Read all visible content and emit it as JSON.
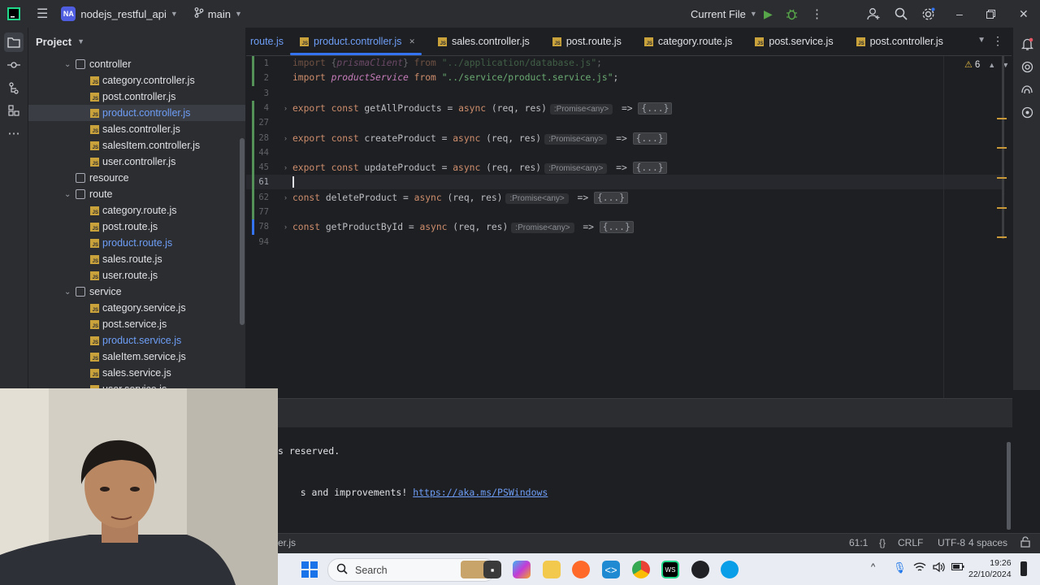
{
  "titlebar": {
    "project_badge": "NA",
    "project_name": "nodejs_restful_api",
    "branch": "main",
    "run_config": "Current File"
  },
  "project_panel": {
    "title": "Project",
    "tree": [
      {
        "type": "folder",
        "label": "controller",
        "indent": 1,
        "open": true
      },
      {
        "type": "file",
        "label": "category.controller.js",
        "indent": 2
      },
      {
        "type": "file",
        "label": "post.controller.js",
        "indent": 2
      },
      {
        "type": "file",
        "label": "product.controller.js",
        "indent": 2,
        "selected": true,
        "highlight": true
      },
      {
        "type": "file",
        "label": "sales.controller.js",
        "indent": 2
      },
      {
        "type": "file",
        "label": "salesItem.controller.js",
        "indent": 2
      },
      {
        "type": "file",
        "label": "user.controller.js",
        "indent": 2
      },
      {
        "type": "folder",
        "label": "resource",
        "indent": 1,
        "open": false
      },
      {
        "type": "folder",
        "label": "route",
        "indent": 1,
        "open": true
      },
      {
        "type": "file",
        "label": "category.route.js",
        "indent": 2
      },
      {
        "type": "file",
        "label": "post.route.js",
        "indent": 2
      },
      {
        "type": "file",
        "label": "product.route.js",
        "indent": 2,
        "highlight": true
      },
      {
        "type": "file",
        "label": "sales.route.js",
        "indent": 2
      },
      {
        "type": "file",
        "label": "user.route.js",
        "indent": 2
      },
      {
        "type": "folder",
        "label": "service",
        "indent": 1,
        "open": true
      },
      {
        "type": "file",
        "label": "category.service.js",
        "indent": 2
      },
      {
        "type": "file",
        "label": "post.service.js",
        "indent": 2
      },
      {
        "type": "file",
        "label": "product.service.js",
        "indent": 2,
        "highlight": true
      },
      {
        "type": "file",
        "label": "saleItem.service.js",
        "indent": 2
      },
      {
        "type": "file",
        "label": "sales.service.js",
        "indent": 2
      },
      {
        "type": "file",
        "label": "user.service.js",
        "indent": 2
      }
    ]
  },
  "tabs": [
    {
      "label": "route.js",
      "active": false,
      "partial": true
    },
    {
      "label": "product.controller.js",
      "active": true,
      "closable": true
    },
    {
      "label": "sales.controller.js",
      "active": false
    },
    {
      "label": "post.route.js",
      "active": false
    },
    {
      "label": "category.route.js",
      "active": false
    },
    {
      "label": "post.service.js",
      "active": false
    },
    {
      "label": "post.controller.js",
      "active": false
    }
  ],
  "editor": {
    "warnings_count": "6",
    "lines": [
      {
        "num": "1",
        "html": "<span class='dim'><span class='kw'>import</span> {<span class='it'>prismaClient</span>} <span class='kw'>from</span> <span class='str'>\"../application/database.js\"</span>;</span>"
      },
      {
        "num": "2",
        "html": "<span class='kw'>import</span> <span class='it'>productService</span> <span class='kw'>from</span> <span class='str'>\"../service/product.service.js\"</span>;"
      },
      {
        "num": "3",
        "html": ""
      },
      {
        "num": "4",
        "fold": true,
        "html": "<span class='kw'>export const</span> getAllProducts = <span class='kw'>async</span> (req, res)<span class='hint'>:Promise&lt;any&gt;</span> =&gt; <span class='folded'>{...}</span>"
      },
      {
        "num": "27",
        "html": ""
      },
      {
        "num": "28",
        "fold": true,
        "html": "<span class='kw'>export const</span> createProduct = <span class='kw'>async</span> (req, res)<span class='hint'>:Promise&lt;any&gt;</span> =&gt; <span class='folded'>{...}</span>"
      },
      {
        "num": "44",
        "html": ""
      },
      {
        "num": "45",
        "fold": true,
        "html": "<span class='kw'>export const</span> updateProduct = <span class='kw'>async</span> (req, res)<span class='hint'>:Promise&lt;any&gt;</span> =&gt; <span class='folded'>{...}</span>"
      },
      {
        "num": "61",
        "current": true,
        "html": ""
      },
      {
        "num": "62",
        "fold": true,
        "html": "<span class='kw'>const</span> deleteProduct = <span class='kw'>async</span> (req, res)<span class='hint'>:Promise&lt;any&gt;</span> =&gt; <span class='folded'>{...}</span>"
      },
      {
        "num": "77",
        "html": ""
      },
      {
        "num": "78",
        "fold": true,
        "html": "<span class='kw'>const</span> getProductById = <span class='kw'>async</span> (req, res)<span class='hint'>:Promise&lt;any&gt;</span> =&gt; <span class='folded'>{...}</span>"
      },
      {
        "num": "94",
        "html": ""
      }
    ]
  },
  "terminal": {
    "line1": "s reserved.",
    "line2_prefix": "s and improvements! ",
    "line2_link": "https://aka.ms/PSWindows",
    "file_label": "er.js"
  },
  "statusbar": {
    "position": "61:1",
    "braces": "{}",
    "line_ending": "CRLF",
    "encoding": "UTF-8",
    "indent": "4 spaces"
  },
  "taskbar": {
    "search_placeholder": "Search",
    "time": "19:26",
    "date": "22/10/2024"
  },
  "colors": {
    "accent": "#3574f0",
    "keyword": "#cf8e6d",
    "string": "#6aab73",
    "highlight_file": "#6e9ef7"
  },
  "icons": {
    "toolstrip": [
      "folder-icon",
      "commit-icon",
      "structure-icon",
      "plugins-icon",
      "more-icon"
    ],
    "rightstrip": [
      "notifications-icon",
      "ai-assistant-icon",
      "copilot-icon",
      "endpoints-icon"
    ]
  }
}
